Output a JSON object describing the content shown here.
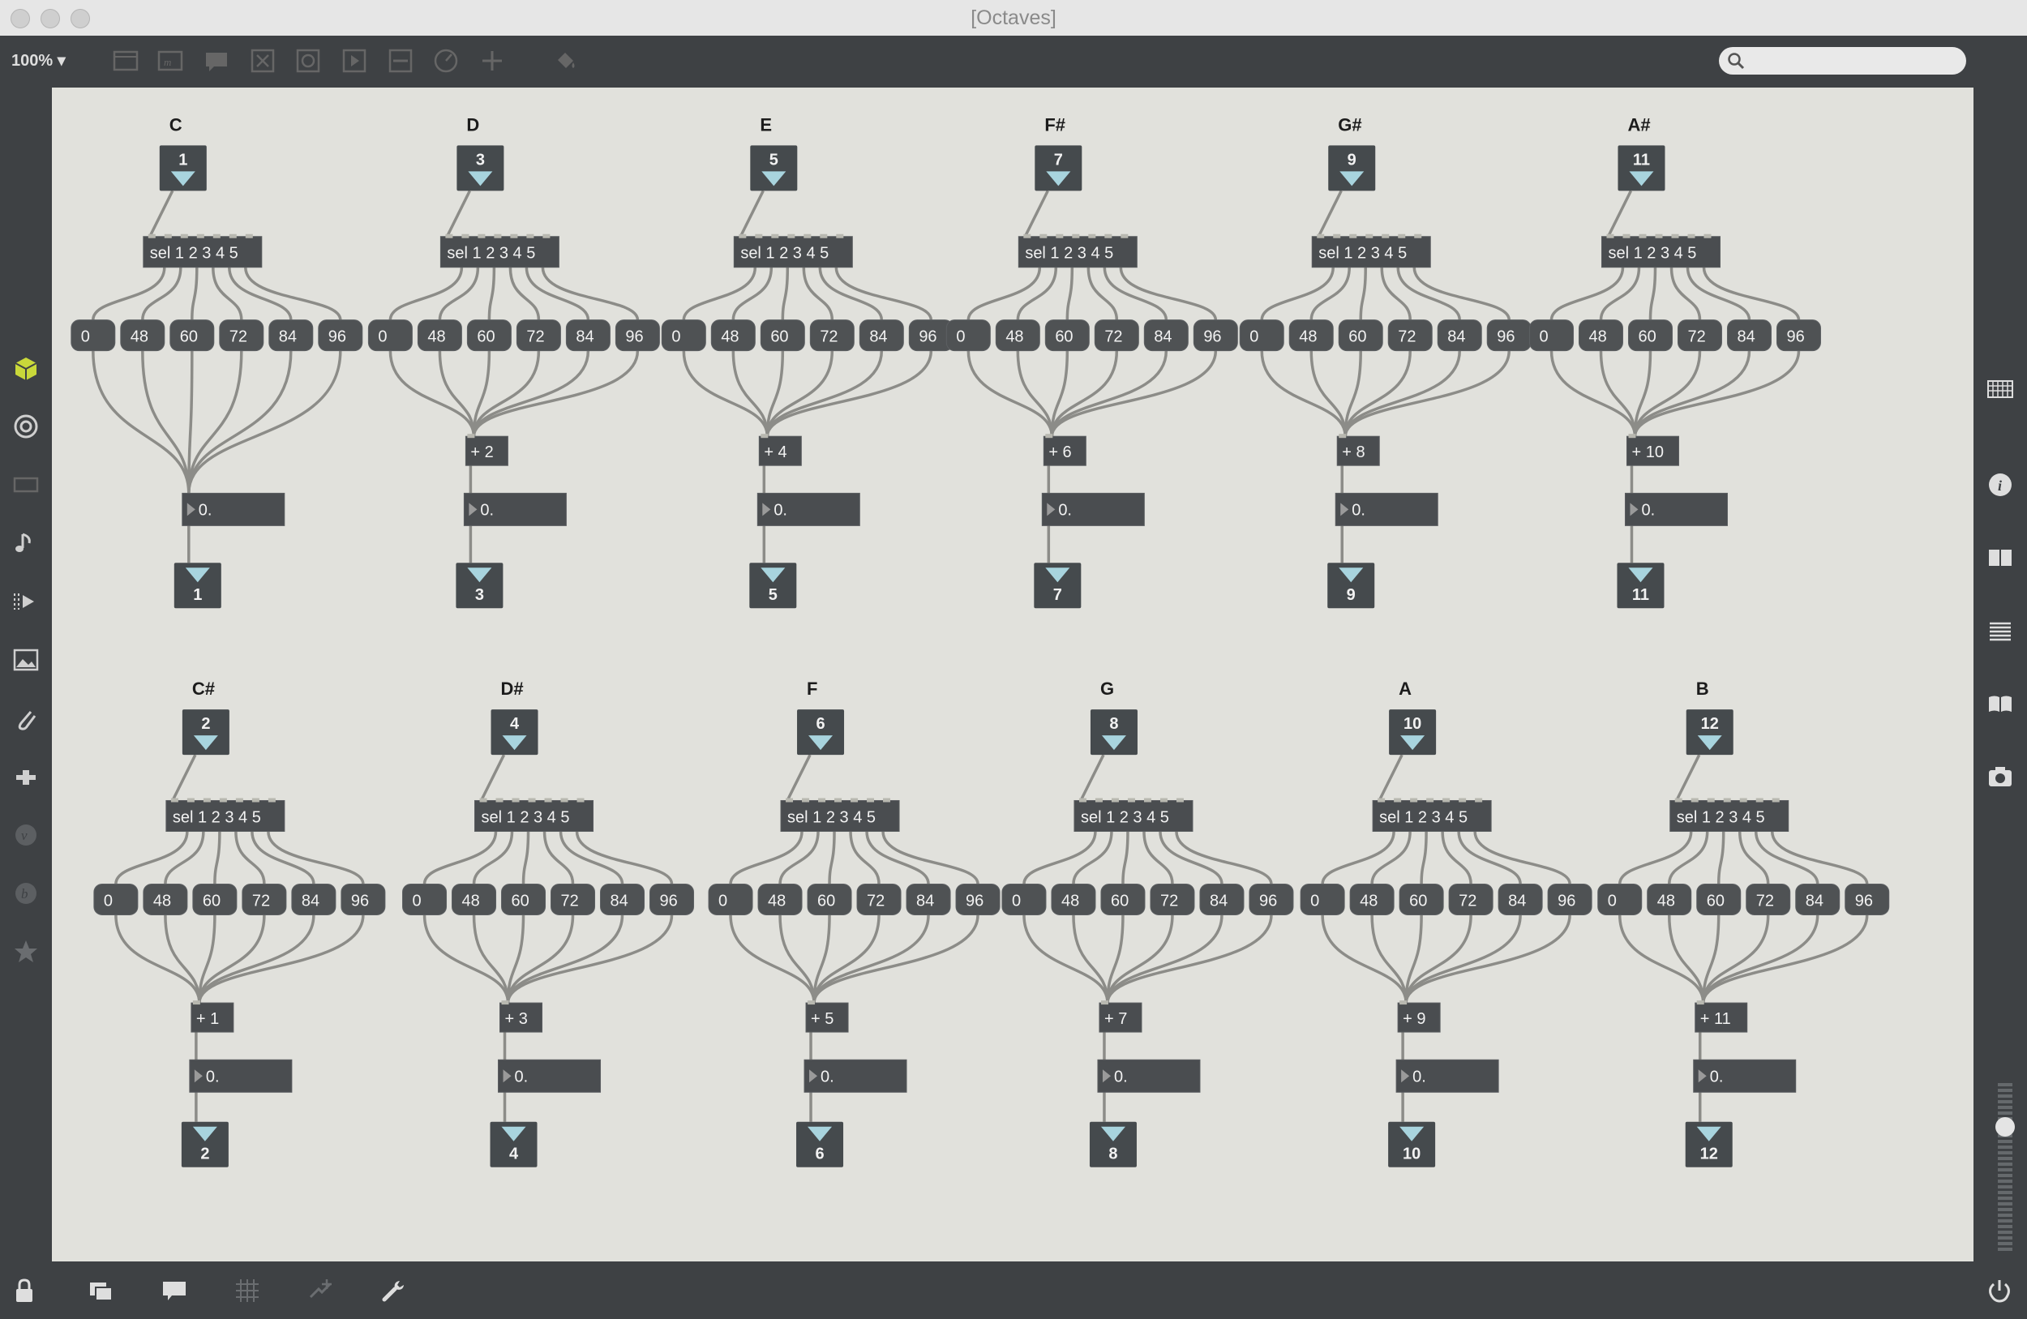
{
  "window": {
    "title": "[Octaves]"
  },
  "toolbar": {
    "zoom": "100% ▾",
    "search_placeholder": ""
  },
  "patch": {
    "select_object": "sel 1 2 3 4 5",
    "octave_messages": [
      "0",
      "48",
      "60",
      "72",
      "84",
      "96"
    ],
    "float_value": "0.",
    "rows": [
      [
        {
          "note": "C",
          "inlet": "1",
          "add": "",
          "outlet": "1"
        },
        {
          "note": "D",
          "inlet": "3",
          "add": "+ 2",
          "outlet": "3"
        },
        {
          "note": "E",
          "inlet": "5",
          "add": "+ 4",
          "outlet": "5"
        },
        {
          "note": "F#",
          "inlet": "7",
          "add": "+ 6",
          "outlet": "7"
        },
        {
          "note": "G#",
          "inlet": "9",
          "add": "+ 8",
          "outlet": "9"
        },
        {
          "note": "A#",
          "inlet": "11",
          "add": "+ 10",
          "outlet": "11"
        }
      ],
      [
        {
          "note": "C#",
          "inlet": "2",
          "add": "+ 1",
          "outlet": "2"
        },
        {
          "note": "D#",
          "inlet": "4",
          "add": "+ 3",
          "outlet": "4"
        },
        {
          "note": "F",
          "inlet": "6",
          "add": "+ 5",
          "outlet": "6"
        },
        {
          "note": "G",
          "inlet": "8",
          "add": "+ 7",
          "outlet": "8"
        },
        {
          "note": "A",
          "inlet": "10",
          "add": "+ 9",
          "outlet": "10"
        },
        {
          "note": "B",
          "inlet": "12",
          "add": "+ 11",
          "outlet": "12"
        }
      ]
    ]
  },
  "left_sidebar": [
    "package-icon",
    "browser-icon",
    "preview-icon",
    "music-icon",
    "media-icon",
    "image-icon",
    "clip-icon",
    "plugin-icon",
    "vizzie-icon",
    "beap-icon",
    "favorites-icon"
  ],
  "right_sidebar": [
    "grid-icon",
    "info-icon",
    "book-icon",
    "list-icon",
    "reference-icon",
    "snapshot-icon"
  ],
  "bottom_bar": [
    "lock-icon",
    "presentation-icon",
    "comment-icon",
    "grid-icon",
    "connect-icon",
    "wrench-icon",
    "power-icon"
  ]
}
